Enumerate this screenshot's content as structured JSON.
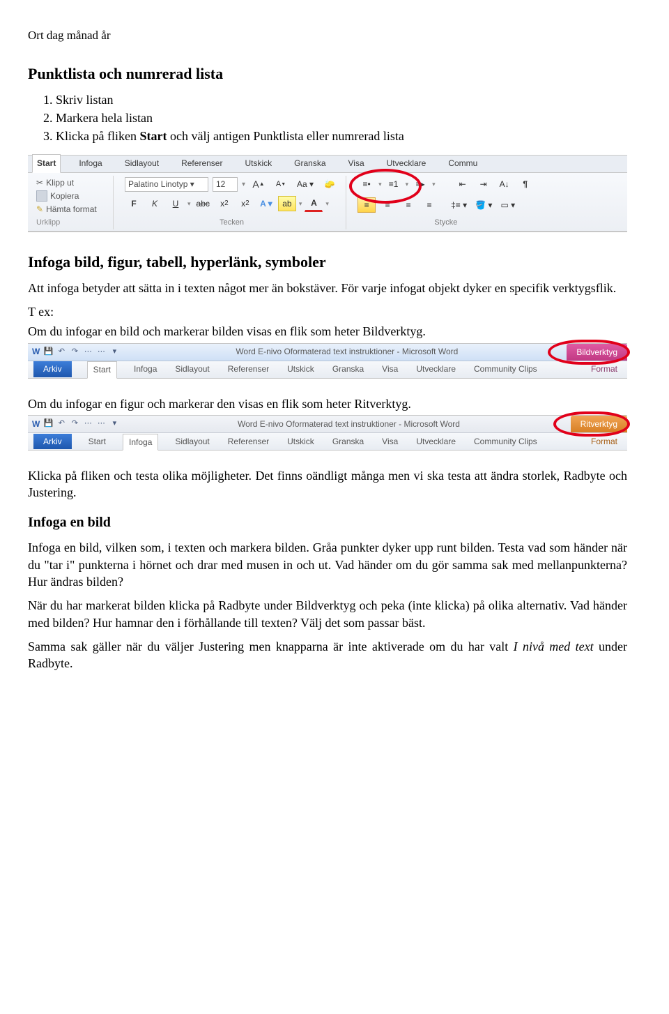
{
  "header_meta": "Ort dag månad år",
  "s1_title": "Punktlista och numrerad lista",
  "s1_steps": [
    "Skriv listan",
    "Markera hela listan",
    "Klicka på fliken Start och välj antigen Punktlista eller numrerad lista"
  ],
  "s1_bold_in_step3": "Start",
  "ribbon1": {
    "tabs": [
      "Start",
      "Infoga",
      "Sidlayout",
      "Referenser",
      "Utskick",
      "Granska",
      "Visa",
      "Utvecklare",
      "Commu"
    ],
    "clipboard": {
      "cut": "Klipp ut",
      "copy": "Kopiera",
      "painter": "Hämta format",
      "group": "Urklipp"
    },
    "font": {
      "name": "Palatino Linotyp",
      "size": "12",
      "group": "Tecken"
    },
    "para_group": "Stycke"
  },
  "s2_title": "Infoga bild, figur, tabell, hyperlänk, symboler",
  "s2_p1": "Att infoga betyder att sätta in i texten något mer än bokstäver. För varje infogat objekt dyker en specifik verktygsflik.",
  "s2_tex_label": "T ex:",
  "s2_ex1": "Om du infogar en bild och markerar bilden visas en flik som heter Bildverktyg.",
  "shot1": {
    "title": "Word E-nivo Oformaterad text instruktioner - Microsoft Word",
    "context": "Bildverktyg",
    "tabs": [
      "Arkiv",
      "Start",
      "Infoga",
      "Sidlayout",
      "Referenser",
      "Utskick",
      "Granska",
      "Visa",
      "Utvecklare",
      "Community Clips",
      "Format"
    ]
  },
  "s2_ex2": "Om du infogar en figur och markerar den visas en flik som heter Ritverktyg.",
  "shot2": {
    "title": "Word E-nivo Oformaterad text instruktioner - Microsoft Word",
    "context": "Ritverktyg",
    "tabs": [
      "Arkiv",
      "Start",
      "Infoga",
      "Sidlayout",
      "Referenser",
      "Utskick",
      "Granska",
      "Visa",
      "Utvecklare",
      "Community Clips",
      "Format"
    ]
  },
  "s2_p2": "Klicka på fliken och testa olika möjligheter. Det finns oändligt många men vi ska testa att ändra storlek, Radbyte och Justering.",
  "s3_title": "Infoga en bild",
  "s3_p1": "Infoga en bild, vilken som, i texten och markera bilden. Gråa punkter dyker upp runt bilden. Testa vad som händer när du \"tar i\" punkterna i hörnet och drar med musen in och ut. Vad händer om du gör samma sak med mellanpunkterna? Hur ändras bilden?",
  "s3_p2": "När du har markerat bilden klicka på Radbyte under Bildverktyg och peka (inte klicka) på olika alternativ. Vad händer med bilden? Hur hamnar den i förhållande till texten? Välj det som passar bäst.",
  "s3_p3_a": "Samma sak gäller när du väljer Justering men knapparna är inte aktiverade om du har valt ",
  "s3_p3_i": "I nivå med text",
  "s3_p3_b": " under Radbyte."
}
